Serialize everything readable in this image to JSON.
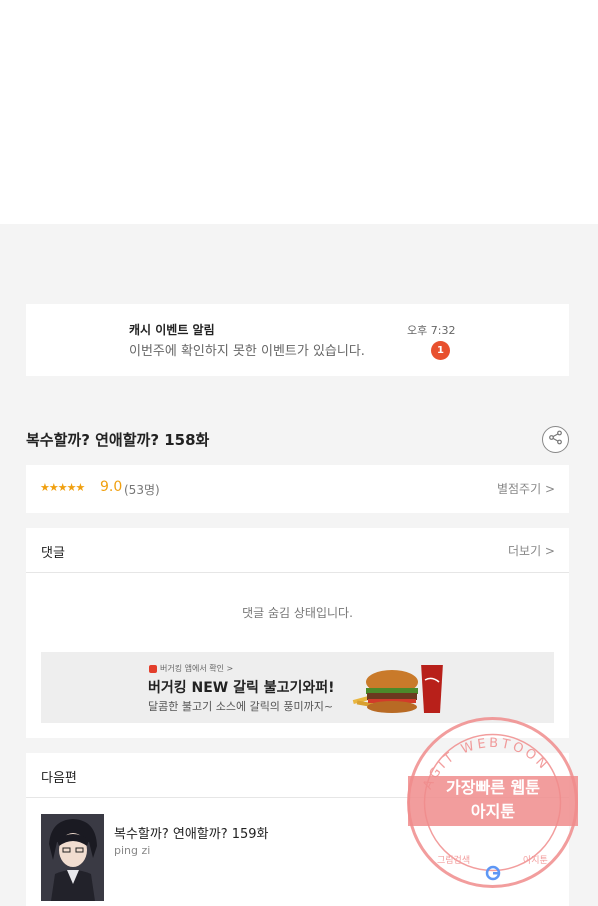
{
  "notification": {
    "title": "캐시 이벤트 알림",
    "body": "이번주에 확인하지 못한 이벤트가 있습니다.",
    "time": "오후 7:32",
    "badge": "1"
  },
  "episode": {
    "title": "복수할까? 연애할까? 158화",
    "share_icon": "share-icon"
  },
  "rating": {
    "stars": "★★★★★",
    "score": "9.0",
    "count": "(53명)",
    "rate_link": "별점주기 >"
  },
  "comments": {
    "title": "댓글",
    "more": "더보기 >",
    "hidden_message": "댓글 숨김 상태입니다."
  },
  "ad": {
    "source": "버거킹 앱에서 확인 >",
    "headline": "버거킹 NEW 갈릭 불고기와퍼!",
    "subtext": "달콤한 불고기 소스에 갈릭의 풍미까지~"
  },
  "next_episode": {
    "section_title": "다음편",
    "title": "복수할까? 연애할까? 159화",
    "author": "ping zi"
  },
  "watermark": {
    "ring_text": "AGIT WEBTOON",
    "line1": "가장빠른 웹툰",
    "line2": "아지툰",
    "bottom_left": "그림검색",
    "bottom_right": "아지툰"
  },
  "colors": {
    "accent_orange": "#f0a010",
    "badge_red": "#e8502e",
    "watermark_pink": "#f08c8c"
  }
}
